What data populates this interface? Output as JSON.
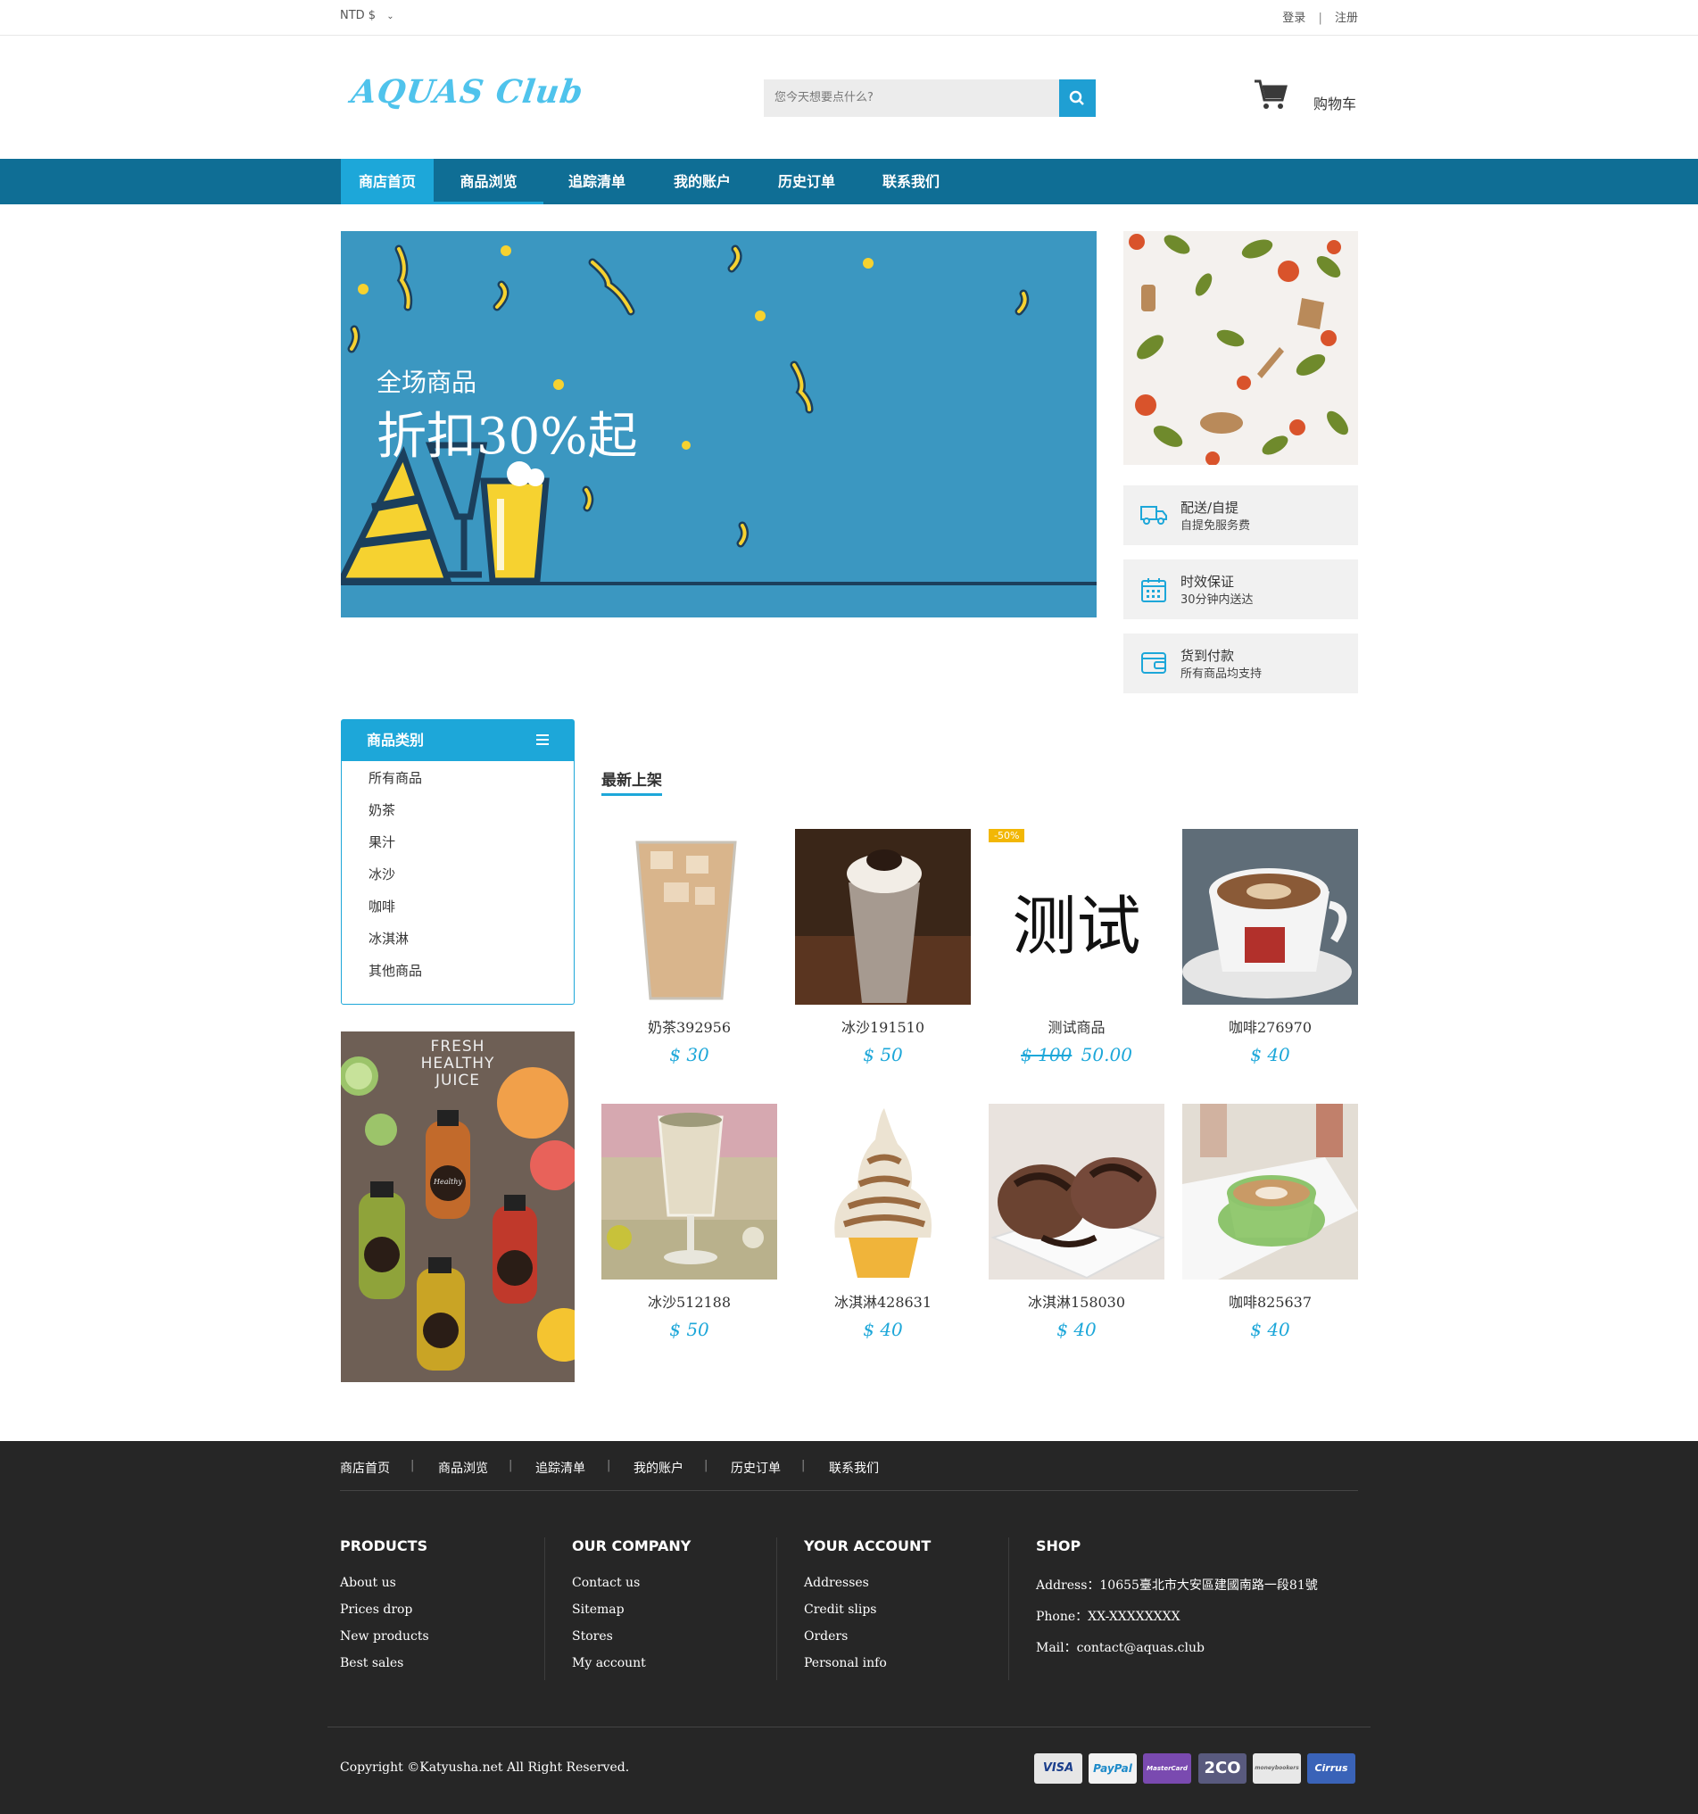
{
  "topbar": {
    "currency": "NTD $",
    "login": "登录",
    "sep": "|",
    "register": "注册"
  },
  "header": {
    "logo": "AQUAS Club",
    "search_placeholder": "您今天想要点什么?",
    "cart_label": "购物车"
  },
  "nav": [
    "商店首页",
    "商品浏览",
    "追踪清单",
    "我的账户",
    "历史订单",
    "联系我们"
  ],
  "hero": {
    "sub": "全场商品",
    "main": "折扣30%起"
  },
  "services": [
    {
      "title": "配送/自提",
      "desc": "自提免服务费"
    },
    {
      "title": "时效保证",
      "desc": "30分钟内送达"
    },
    {
      "title": "货到付款",
      "desc": "所有商品均支持"
    }
  ],
  "categories": {
    "title": "商品类别",
    "items": [
      "所有商品",
      "奶茶",
      "果汁",
      "冰沙",
      "咖啡",
      "冰淇淋",
      "其他商品"
    ]
  },
  "promo": {
    "line1": "FRESH",
    "line2": "HEALTHY",
    "line3": "JUICE",
    "label": "Healthy"
  },
  "products_section": {
    "title": "最新上架"
  },
  "products": [
    {
      "name": "奶茶392956",
      "price": "$ 30"
    },
    {
      "name": "冰沙191510",
      "price": "$ 50"
    },
    {
      "name": "测试商品",
      "old_price": "$ 100",
      "price": "50.00",
      "badge": "-50%",
      "image_text": "测试"
    },
    {
      "name": "咖啡276970",
      "price": "$ 40"
    },
    {
      "name": "冰沙512188",
      "price": "$ 50"
    },
    {
      "name": "冰淇淋428631",
      "price": "$ 40"
    },
    {
      "name": "冰淇淋158030",
      "price": "$ 40"
    },
    {
      "name": "咖啡825637",
      "price": "$ 40"
    }
  ],
  "footer": {
    "nav": [
      "商店首页",
      "商品浏览",
      "追踪清单",
      "我的账户",
      "历史订单",
      "联系我们"
    ],
    "sep": "|",
    "columns": [
      {
        "title": "PRODUCTS",
        "links": [
          "About us",
          "Prices drop",
          "New products",
          "Best sales"
        ]
      },
      {
        "title": "OUR COMPANY",
        "links": [
          "Contact us",
          "Sitemap",
          "Stores",
          "My account"
        ]
      },
      {
        "title": "YOUR ACCOUNT",
        "links": [
          "Addresses",
          "Credit slips",
          "Orders",
          "Personal info"
        ]
      },
      {
        "title": "SHOP",
        "links": [
          "Address：10655臺北市大安區建國南路一段81號",
          "Phone：XX-XXXXXXXX",
          "Mail：contact@aquas.club"
        ]
      }
    ],
    "copyright": "Copyright ©Katyusha.net All Right Reserved.",
    "payments": [
      "VISA",
      "PayPal",
      "MasterCard",
      "2CO",
      "moneybookers",
      "Cirrus"
    ]
  },
  "colors": {
    "primary": "#1da7d9",
    "nav": "#0f6e95",
    "footer": "#262626",
    "badge": "#f2b705"
  }
}
